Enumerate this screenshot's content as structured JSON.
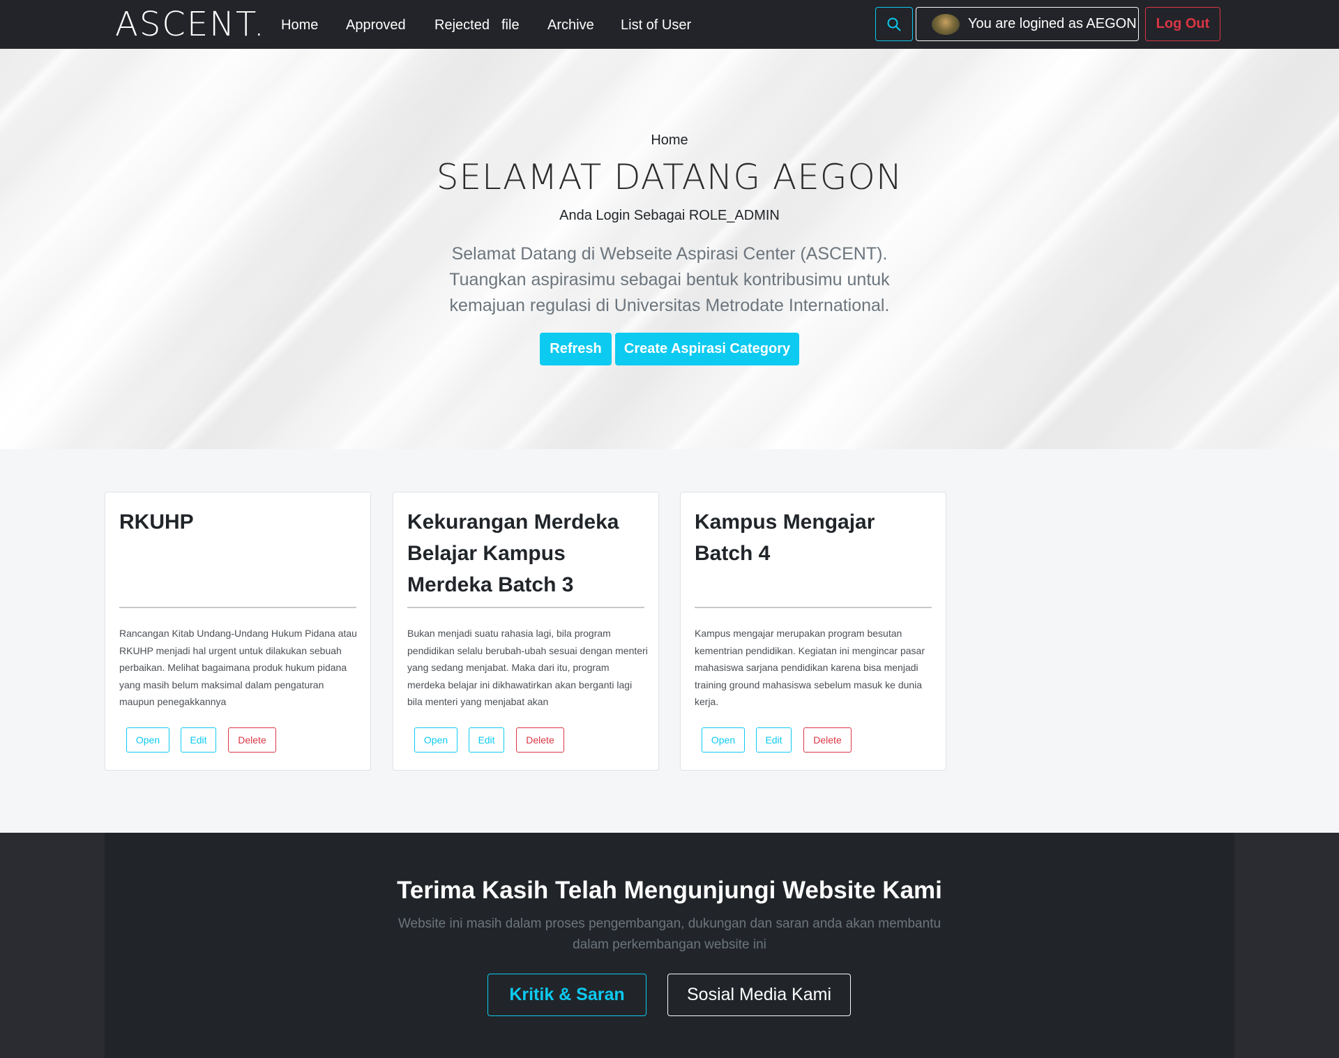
{
  "navbar": {
    "brand": "ASCENT.",
    "links": [
      "Home",
      "Approved",
      "Rejected",
      "file",
      "Archive",
      "List of User"
    ],
    "search_icon": "search-icon",
    "user_label": "You are logined as AEGON",
    "logout_label": "Log Out"
  },
  "hero": {
    "breadcrumb": "Home",
    "title": "SELAMAT DATANG AEGON",
    "role": "Anda Login Sebagai ROLE_ADMIN",
    "lead": "Selamat Datang di Webseite Aspirasi Center (ASCENT). Tuangkan aspirasimu sebagai bentuk kontribusimu untuk kemajuan regulasi di Universitas Metrodate International.",
    "refresh_label": "Refresh",
    "create_label": "Create Aspirasi Category"
  },
  "cards": [
    {
      "title": "RKUHP",
      "text": "Rancangan Kitab Undang-Undang Hukum Pidana atau RKUHP menjadi hal urgent untuk dilakukan sebuah perbaikan. Melihat bagaimana produk hukum pidana yang masih belum maksimal dalam pengaturan maupun penegakkannya",
      "open": "Open",
      "edit": "Edit",
      "delete": "Delete"
    },
    {
      "title": "Kekurangan Merdeka Belajar Kampus Merdeka Batch 3",
      "text": "Bukan menjadi suatu rahasia lagi, bila program pendidikan selalu berubah-ubah sesuai dengan menteri yang sedang menjabat. Maka dari itu, program merdeka belajar ini dikhawatirkan akan berganti lagi bila menteri yang menjabat akan",
      "open": "Open",
      "edit": "Edit",
      "delete": "Delete"
    },
    {
      "title": "Kampus Mengajar Batch 4",
      "text": "Kampus mengajar merupakan program besutan kementrian pendidikan. Kegiatan ini mengincar pasar mahasiswa sarjana pendidikan karena bisa menjadi training ground mahasiswa sebelum masuk ke dunia kerja.",
      "open": "Open",
      "edit": "Edit",
      "delete": "Delete"
    }
  ],
  "footer": {
    "title": "Terima Kasih Telah Mengunjungi Website Kami",
    "text": "Website ini masih dalam proses pengembangan, dukungan dan saran anda akan membantu dalam perkembangan website ini",
    "kritik_label": "Kritik & Saran",
    "sosial_label": "Sosial Media Kami"
  },
  "colors": {
    "navbar_bg": "#222429",
    "accent": "#0dcaf0",
    "danger": "#dc3545",
    "footer_bg": "#212529"
  }
}
